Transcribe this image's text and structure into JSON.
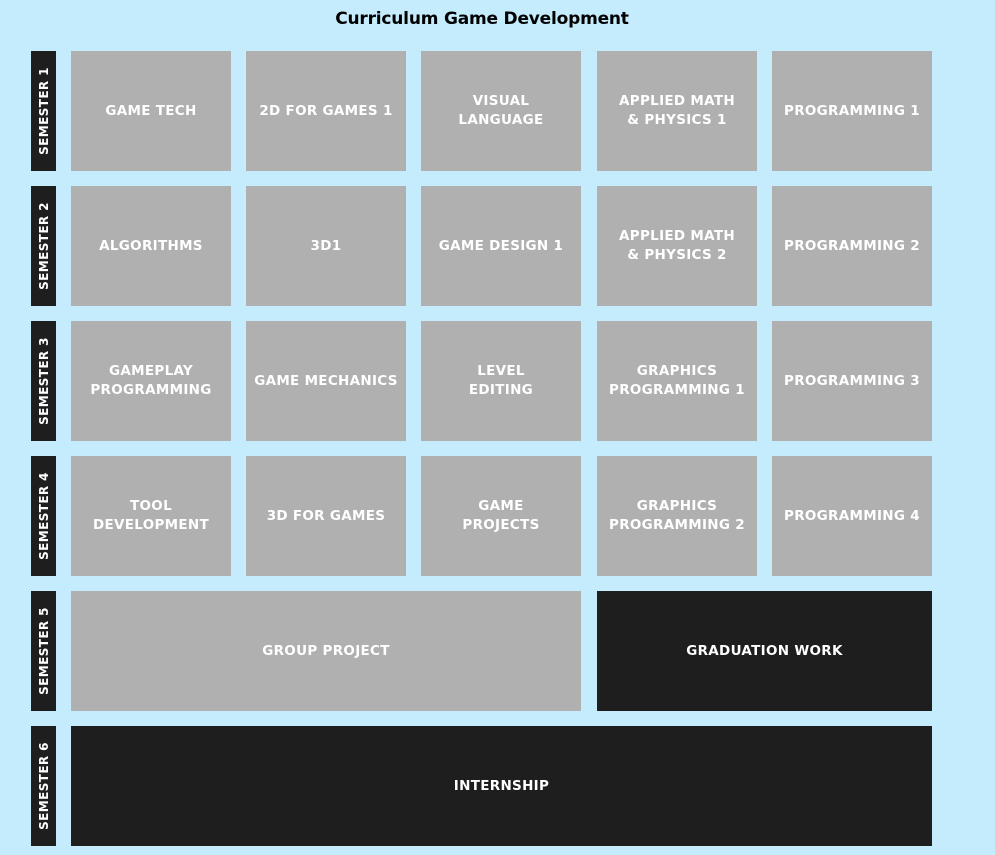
{
  "title": "Curriculum Game Development",
  "semesters": [
    "SEMESTER 1",
    "SEMESTER 2",
    "SEMESTER 3",
    "SEMESTER 4",
    "SEMESTER 5",
    "SEMESTER 6"
  ],
  "courses": {
    "semester1": [
      "GAME TECH",
      "2D FOR GAMES 1",
      "VISUAL\nLANGUAGE",
      "APPLIED MATH\n& PHYSICS 1",
      "PROGRAMMING 1"
    ],
    "semester2": [
      "ALGORITHMS",
      "3D1",
      "GAME DESIGN 1",
      "APPLIED MATH\n& PHYSICS 2",
      "PROGRAMMING 2"
    ],
    "semester3": [
      "GAMEPLAY\nPROGRAMMING",
      "GAME MECHANICS",
      "LEVEL\nEDITING",
      "GRAPHICS\nPROGRAMMING 1",
      "PROGRAMMING 3"
    ],
    "semester4": [
      "TOOL\nDEVELOPMENT",
      "3D FOR GAMES",
      "GAME\nPROJECTS",
      "GRAPHICS\nPROGRAMMING 2",
      "PROGRAMMING 4"
    ],
    "semester5": [
      "GROUP PROJECT",
      "GRADUATION WORK"
    ],
    "semester6": [
      "INTERNSHIP"
    ]
  },
  "colors": {
    "background": "#c5ecfc",
    "course_grey": "#b0b0b0",
    "course_dark": "#1e1e1e",
    "label_dark": "#1e1e1e",
    "text_light": "#ffffff"
  }
}
